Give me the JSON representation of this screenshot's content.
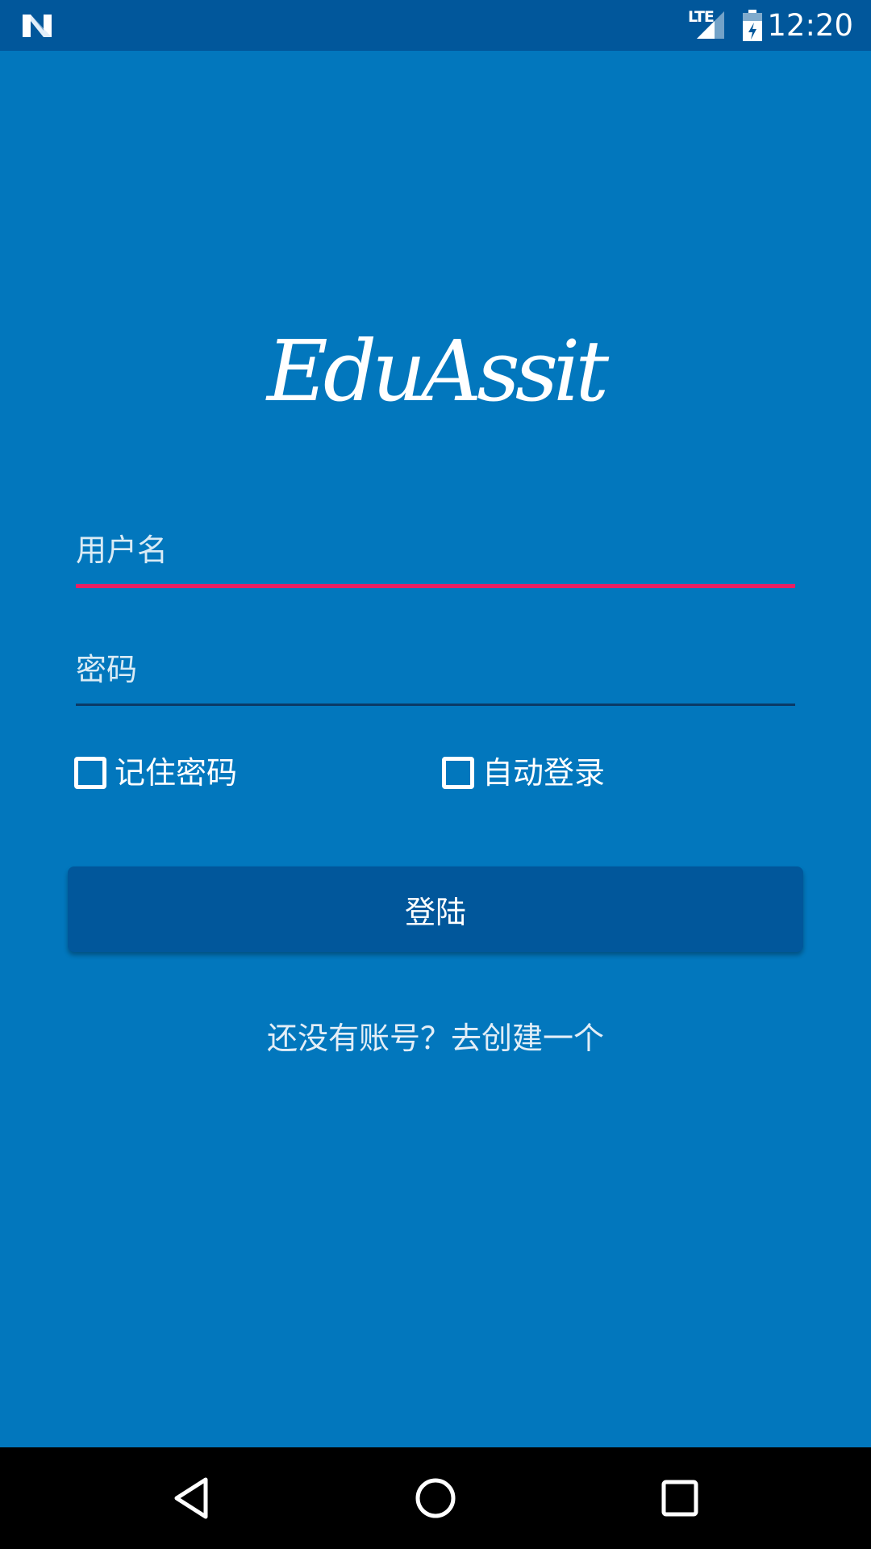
{
  "status_bar": {
    "network_label": "LTE",
    "time": "12:20",
    "icons": [
      "notification-n-icon",
      "signal-icon",
      "battery-icon"
    ]
  },
  "app": {
    "logo_text": "EduAssit"
  },
  "login_form": {
    "username_placeholder": "用户名",
    "password_placeholder": "密码",
    "remember_password_label": "记住密码",
    "auto_login_label": "自动登录",
    "login_button_label": "登陆",
    "register_prompt": "还没有账号？去创建一个"
  },
  "colors": {
    "background": "#0277BD",
    "status_bar": "#01579B",
    "button": "#01579B",
    "focused_underline": "#E91E63",
    "unfocused_underline": "#0A3A66",
    "nav_bar": "#000000"
  },
  "nav_bar": {
    "icons": [
      "back-icon",
      "home-icon",
      "recents-icon"
    ]
  }
}
